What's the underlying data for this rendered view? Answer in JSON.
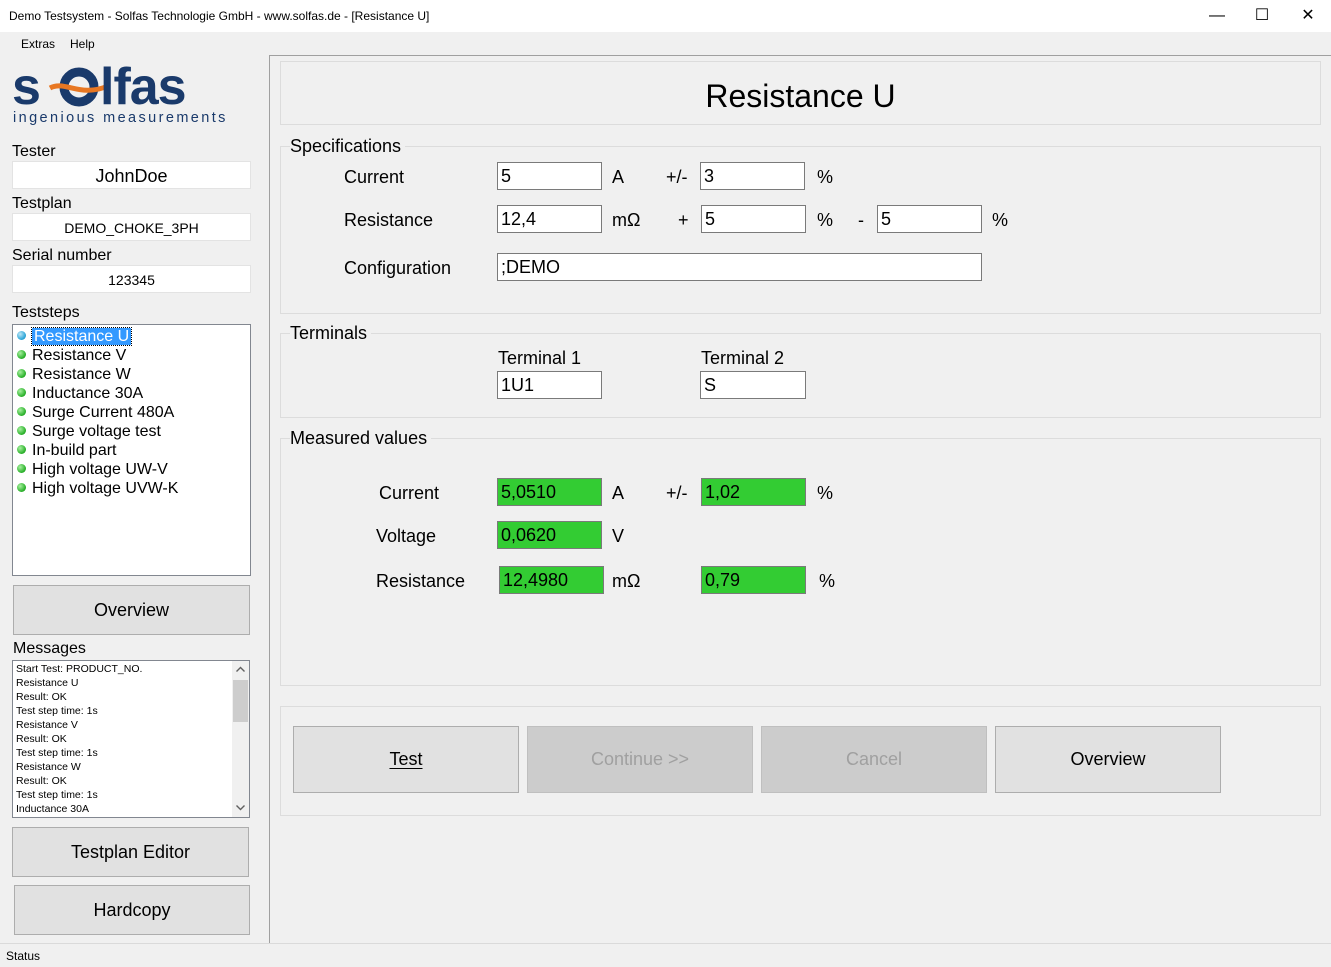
{
  "window": {
    "title": "Demo Testsystem - Solfas Technologie GmbH - www.solfas.de - [Resistance U]",
    "minimize": "—",
    "maximize": "☐",
    "close": "✕"
  },
  "menu": [
    "Extras",
    "Help"
  ],
  "logo": {
    "wordmark": "solfas",
    "tagline": "ingenious measurements",
    "color_dark": "#1a3a6b",
    "color_accent": "#e87722"
  },
  "left": {
    "tester_label": "Tester",
    "tester_value": "JohnDoe",
    "testplan_label": "Testplan",
    "testplan_value": "DEMO_CHOKE_3PH",
    "serial_label": "Serial number",
    "serial_value": "123345",
    "teststeps_label": "Teststeps",
    "teststeps": [
      "Resistance U",
      "Resistance V",
      "Resistance W",
      "Inductance 30A",
      "Surge Current 480A",
      "Surge voltage test",
      "In-build part",
      "High voltage UW-V",
      "High voltage UVW-K"
    ],
    "overview_button": "Overview",
    "messages_label": "Messages",
    "messages": [
      "Start Test: PRODUCT_NO.",
      "Resistance U",
      "Result: OK",
      "Test step time: 1s",
      "Resistance V",
      "Result: OK",
      "Test step time: 1s",
      "Resistance W",
      "Result: OK",
      "Test step time: 1s",
      "Inductance 30A"
    ],
    "testplan_editor_button": "Testplan Editor",
    "hardcopy_button": "Hardcopy"
  },
  "main": {
    "title": "Resistance U",
    "specifications": {
      "header": "Specifications",
      "current_label": "Current",
      "current_value": "5",
      "current_unit": "A",
      "current_tol_sign": "+/-",
      "current_tol": "3",
      "current_tol_unit": "%",
      "resistance_label": "Resistance",
      "resistance_value": "12,4",
      "resistance_unit": "mΩ",
      "res_plus_sign": "+",
      "res_plus": "5",
      "res_plus_unit": "%",
      "res_minus_sign": "-",
      "res_minus": "5",
      "res_minus_unit": "%",
      "configuration_label": "Configuration",
      "configuration_value": ";DEMO"
    },
    "terminals": {
      "header": "Terminals",
      "t1_label": "Terminal 1",
      "t1_value": "1U1",
      "t2_label": "Terminal 2",
      "t2_value": "S"
    },
    "measured": {
      "header": "Measured values",
      "current_label": "Current",
      "current_value": "5,0510",
      "current_unit": "A",
      "current_tol_sign": "+/-",
      "current_dev": "1,02",
      "current_dev_unit": "%",
      "voltage_label": "Voltage",
      "voltage_value": "0,0620",
      "voltage_unit": "V",
      "resistance_label": "Resistance",
      "resistance_value": "12,4980",
      "resistance_unit": "mΩ",
      "resistance_dev": "0,79",
      "resistance_dev_unit": "%"
    },
    "buttons": {
      "test": "Test",
      "continue": "Continue >>",
      "cancel": "Cancel",
      "overview": "Overview"
    }
  },
  "status": "Status"
}
